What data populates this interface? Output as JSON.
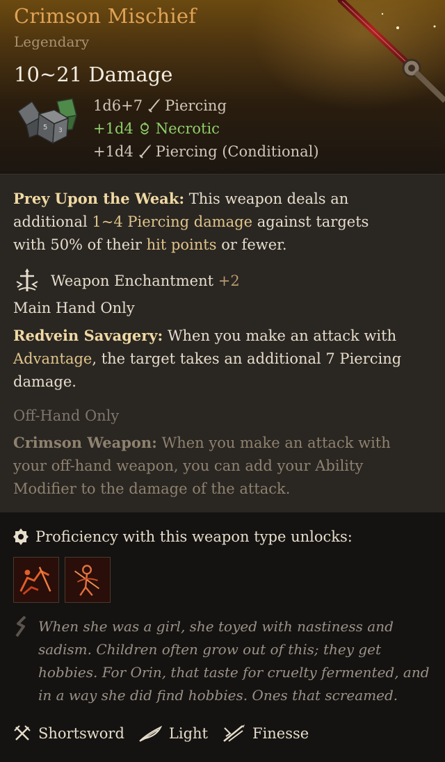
{
  "item": {
    "name": "Crimson Mischief",
    "rarity": "Legendary",
    "damage_total": "10~21 Damage",
    "damage_lines": [
      {
        "dice": "1d6+7",
        "type": "Piercing",
        "icon": "piercing-icon"
      },
      {
        "dice": "+1d4",
        "type": "Necrotic",
        "icon": "necrotic-icon"
      },
      {
        "dice": "+1d4",
        "type": "Piercing (Conditional)",
        "icon": "piercing-icon"
      }
    ]
  },
  "passive": {
    "name": "Prey Upon the Weak:",
    "text_1": " This weapon deals an additional ",
    "highlight_1": "1~4 Piercing damage",
    "text_2": " against targets with 50% of their ",
    "highlight_2": "hit points",
    "text_3": " or fewer."
  },
  "enchantment": {
    "label": "Weapon Enchantment",
    "value": "+2",
    "icon": "enchantment-icon"
  },
  "main_hand": {
    "heading": "Main Hand Only",
    "name": "Redvein Savagery:",
    "text_1": " When you make an attack with ",
    "highlight": "Advantage",
    "text_2": ", the target takes an additional 7 Piercing damage."
  },
  "off_hand": {
    "heading": "Off-Hand Only",
    "name": "Crimson Weapon:",
    "text_1": " When you make an attack with your off-hand weapon, you can add your ",
    "highlight": "Ability Modifier",
    "text_2": " to the damage of the attack."
  },
  "proficiency": {
    "label": "Proficiency with this weapon type unlocks:",
    "actions": [
      {
        "icon": "piercing-strike-icon"
      },
      {
        "icon": "flourish-icon"
      }
    ]
  },
  "lore": "When she was a girl, she toyed with nastiness and sadism. Children often grow out of this; they get hobbies. For Orin, that taste for cruelty fermented, and in a way she did find hobbies. Ones that screamed.",
  "properties": [
    {
      "label": "Shortsword",
      "icon": "shortsword-icon"
    },
    {
      "label": "Light",
      "icon": "feather-icon"
    },
    {
      "label": "Finesse",
      "icon": "finesse-icon"
    }
  ],
  "colors": {
    "title": "#e0a255",
    "necrotic": "#8fcf6a",
    "keyword": "#f0d9a3",
    "panel": "#2a2622",
    "background": "#151311"
  }
}
